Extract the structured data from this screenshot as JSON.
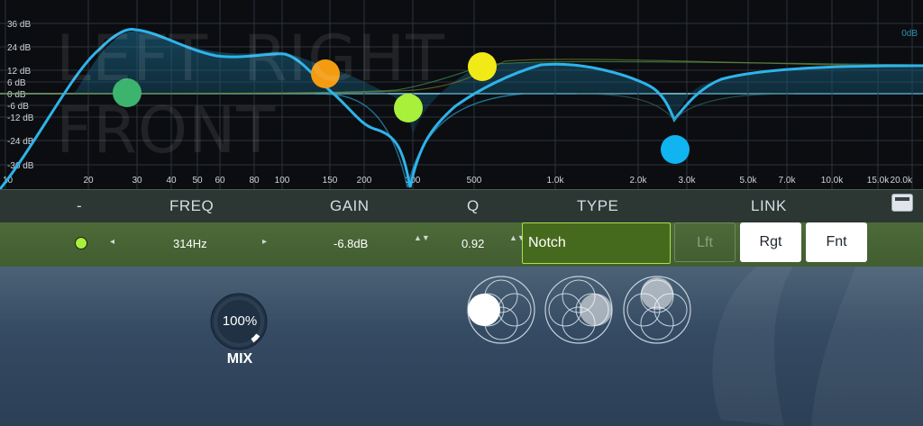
{
  "graph": {
    "db_labels": [
      "36 dB",
      "24 dB",
      "12 dB",
      "6 dB",
      "0 dB",
      "-6 dB",
      "-12 dB",
      "-24 dB",
      "-36 dB"
    ],
    "freq_labels": [
      "10",
      "20",
      "30",
      "40",
      "50",
      "60",
      "80",
      "100",
      "150",
      "200",
      "300",
      "500",
      "1.0k",
      "2.0k",
      "3.0k",
      "5.0k",
      "7.0k",
      "10.0k",
      "15.0k",
      "20.0k"
    ],
    "zero_db_marker": "0dB",
    "ghost_text": {
      "line1a": "LEFT",
      "line1b": "RIGHT",
      "line2": "FRONT"
    },
    "colors": {
      "curve": "#2fb3ea",
      "node1": "#3cb46e",
      "node2": "#f39c12",
      "node3": "#a8f03a",
      "node4": "#f2ea17",
      "node5": "#0fb4f0"
    }
  },
  "columns": {
    "band": "-",
    "freq": "FREQ",
    "gain": "GAIN",
    "q": "Q",
    "type": "TYPE",
    "link": "LINK"
  },
  "band": {
    "freq": "314Hz",
    "gain": "-6.8dB",
    "q": "0.92",
    "type": "Notch",
    "link": {
      "lft": "Lft",
      "rgt": "Rgt",
      "fnt": "Fnt"
    }
  },
  "icons": {
    "left": "◂",
    "right": "▸",
    "updown": "▲▼"
  },
  "mix": {
    "value": "100%",
    "label": "MIX",
    "level": 1.0
  }
}
